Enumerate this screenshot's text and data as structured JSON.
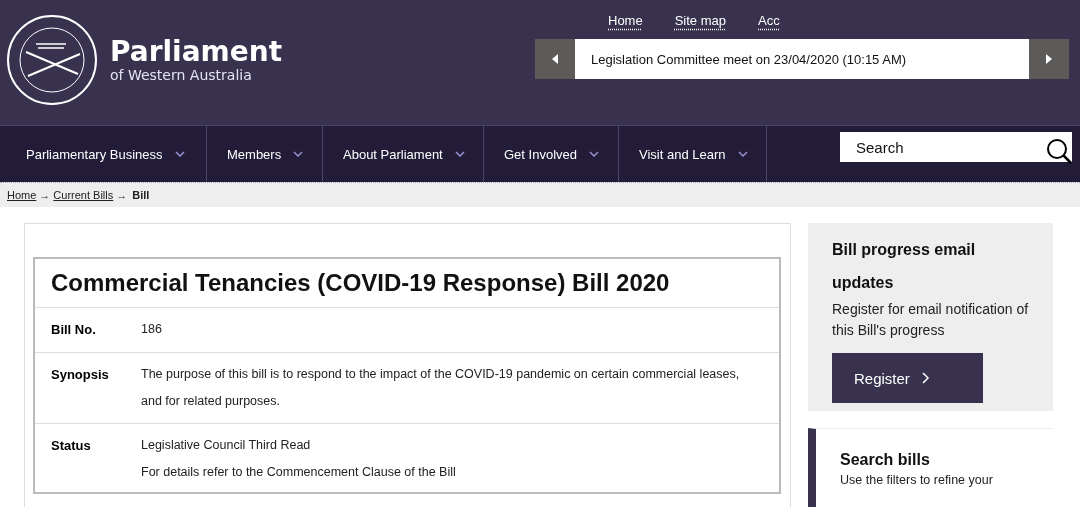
{
  "header": {
    "logo_title": "Parliament",
    "logo_subtitle": "of Western Australia",
    "utility_links": [
      "Home",
      "Site map",
      "Acc"
    ],
    "ticker": {
      "text": "Legislation Committee meet on 23/04/2020 (10:15 AM)"
    }
  },
  "nav": {
    "items": [
      "Parliamentary Business",
      "Members",
      "About Parliament",
      "Get Involved",
      "Visit and Learn"
    ],
    "search": {
      "placeholder": "Search"
    }
  },
  "breadcrumb": {
    "links": [
      "Home",
      "Current Bills"
    ],
    "separator": "→",
    "current": "Bill"
  },
  "bill": {
    "title": "Commercial Tenancies (COVID-19 Response) Bill 2020",
    "rows": [
      {
        "label": "Bill No.",
        "lines": [
          "186"
        ]
      },
      {
        "label": "Synopsis",
        "lines": [
          "The purpose of this bill is to respond to the impact of the COVID-19 pandemic on certain commercial leases, and for related purposes."
        ]
      },
      {
        "label": "Status",
        "lines": [
          "Legislative Council Third Read",
          "For details refer to the Commencement Clause of the Bill"
        ]
      }
    ]
  },
  "sidebar": {
    "email": {
      "title": "Bill progress email updates",
      "text": "Register for email notification of this Bill's progress",
      "button": "Register"
    },
    "search_bills": {
      "title": "Search bills",
      "text": "Use the filters to refine your"
    }
  }
}
